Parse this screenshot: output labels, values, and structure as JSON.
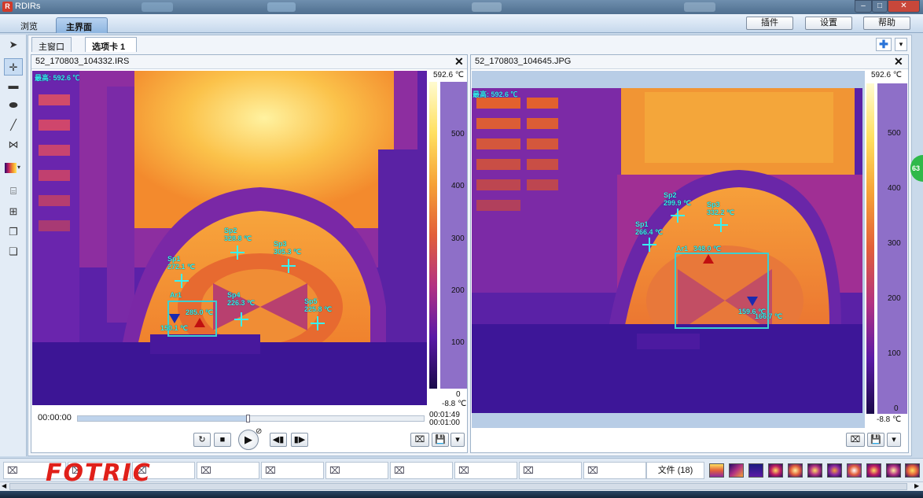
{
  "app": {
    "title": "RDIRs"
  },
  "menu": {
    "tabs": [
      "浏览",
      "主界面"
    ],
    "buttons": [
      "插件",
      "设置",
      "帮助"
    ]
  },
  "doc_tabs": [
    "主窗口",
    "选项卡 1"
  ],
  "left_panel": {
    "filename": "52_170803_104332.IRS",
    "max_label": "最高: 592.6 ℃",
    "scale_top": "592.6 ℃",
    "scale_bottom": "-8.8 ℃",
    "ticks": [
      "500",
      "400",
      "300",
      "200",
      "100",
      "0"
    ],
    "spots": [
      {
        "name": "Sp1",
        "temp": "272.1 ℃"
      },
      {
        "name": "Sp2",
        "temp": "328.8 ℃"
      },
      {
        "name": "Sp3",
        "temp": "305.3 ℃"
      },
      {
        "name": "Sp4",
        "temp": "226.3 ℃"
      },
      {
        "name": "Sp5",
        "temp": "225.8 ℃"
      }
    ],
    "area": {
      "name": "Ar1",
      "max_temp": "285.0 ℃",
      "min_temp": "150.1 ℃"
    },
    "playback": {
      "current": "00:00:00",
      "total": "00:01:49",
      "second": "00:01:00",
      "progress_fraction": 0.49
    }
  },
  "right_panel": {
    "filename": "52_170803_104645.JPG",
    "max_label": "最高: 592.6 ℃",
    "scale_top": "592.6 ℃",
    "scale_bottom": "-8.8 ℃",
    "ticks": [
      "500",
      "400",
      "300",
      "200",
      "100",
      "0"
    ],
    "spots": [
      {
        "name": "Sp1",
        "temp": "266.4 ℃"
      },
      {
        "name": "Sp2",
        "temp": "299.9 ℃"
      },
      {
        "name": "Sp3",
        "temp": "332.2 ℃"
      }
    ],
    "area": {
      "name": "Ar1",
      "max_temp": "348.0 ℃",
      "min_temp1": "159.6 ℃",
      "min_temp2": "166.7 ℃"
    }
  },
  "bottom": {
    "files_label": "文件 (18)",
    "logo": "FOTRIC",
    "badge": "63"
  },
  "colors": {
    "accent": "#3cd0d0",
    "max_marker": "#c01010",
    "min_marker": "#1a2ab0",
    "logo": "#e0201a"
  }
}
